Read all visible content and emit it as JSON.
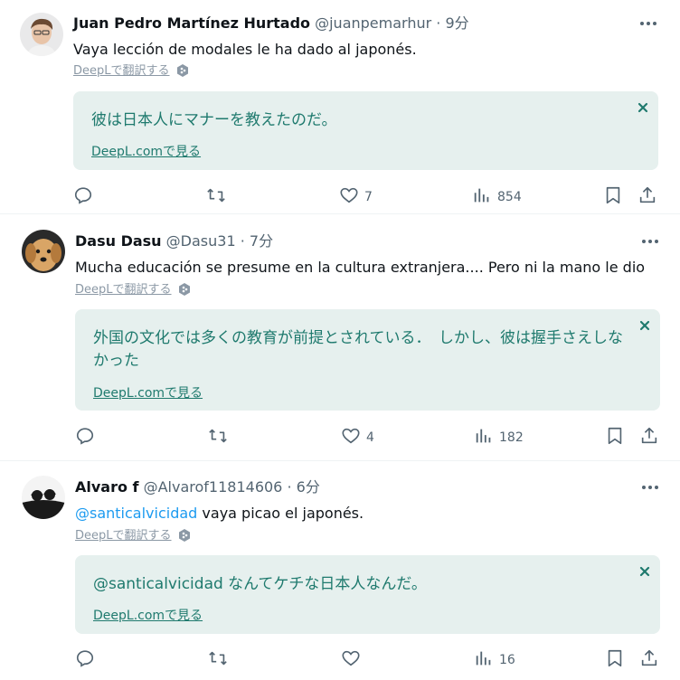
{
  "tweets": [
    {
      "name": "Juan Pedro Martínez Hurtado",
      "handle": "@juanpemarhur",
      "dot": "·",
      "time": "9分",
      "mention": "",
      "text": "Vaya lección de modales le ha dado al japonés.",
      "deepl_link": "DeepLで翻訳する",
      "translation": "彼は日本人にマナーを教えたのだ。",
      "deepl_view": "DeepL.comで見る",
      "likes": "7",
      "views": "854",
      "avatar": "avatar-person-icon"
    },
    {
      "name": "Dasu Dasu",
      "handle": "@Dasu31",
      "dot": "·",
      "time": "7分",
      "mention": "",
      "text": "Mucha educación se presume en la cultura extranjera.... Pero ni la mano le dio",
      "deepl_link": "DeepLで翻訳する",
      "translation": "外国の文化では多くの教育が前提とされている．　しかし、彼は握手さえしなかった",
      "deepl_view": "DeepL.comで見る",
      "likes": "4",
      "views": "182",
      "avatar": "avatar-dog-icon"
    },
    {
      "name": "Alvaro f",
      "handle": "@Alvarof11814606",
      "dot": "·",
      "time": "6分",
      "mention": "@santicalvicidad",
      "text": " vaya picao el japonés.",
      "deepl_link": "DeepLで翻訳する",
      "translation": "@santicalvicidad なんてケチな日本人なんだ。",
      "deepl_view": "DeepL.comで見る",
      "likes": "",
      "views": "16",
      "avatar": "avatar-silhouette-icon"
    }
  ],
  "colors": {
    "accent": "#1d9bf0",
    "translation_bg": "#e6f0ee",
    "translation_text": "#1f7a6e",
    "secondary_text": "#536471"
  },
  "icons": {
    "more": "more-dots-icon",
    "reply": "reply-icon",
    "retweet": "retweet-icon",
    "like": "heart-icon",
    "views": "views-chart-icon",
    "bookmark": "bookmark-icon",
    "share": "share-icon",
    "close": "close-icon",
    "deepl_badge": "deepl-badge-icon"
  }
}
